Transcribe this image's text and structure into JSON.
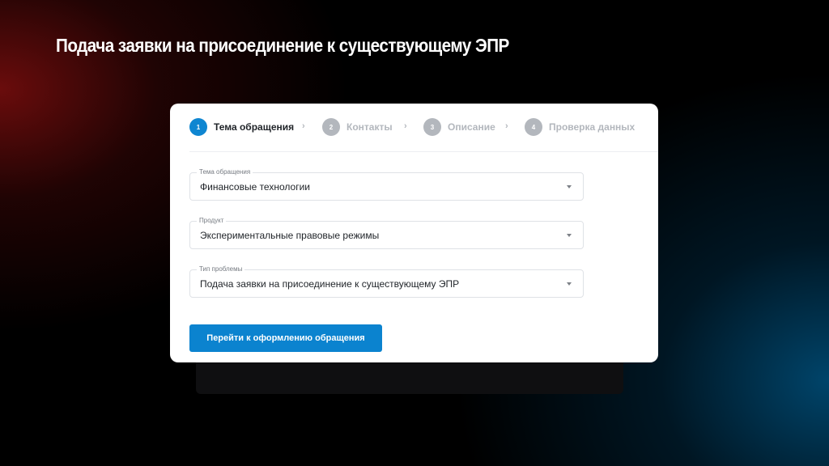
{
  "slide": {
    "title": "Подача заявки на присоединение к существующему ЭПР"
  },
  "stepper": {
    "steps": [
      {
        "number": "1",
        "label": "Тема обращения",
        "active": true
      },
      {
        "number": "2",
        "label": "Контакты",
        "active": false
      },
      {
        "number": "3",
        "label": "Описание",
        "active": false
      },
      {
        "number": "4",
        "label": "Проверка данных",
        "active": false
      }
    ],
    "separator_icon": "chevron-right-icon"
  },
  "form": {
    "topic": {
      "label": "Тема обращения",
      "value": "Финансовые технологии"
    },
    "product": {
      "label": "Продукт",
      "value": "Экспериментальные правовые режимы"
    },
    "problem_type": {
      "label": "Тип проблемы",
      "value": "Подача заявки на присоединение к существующему ЭПР"
    },
    "submit_label": "Перейти к оформлению обращения"
  },
  "colors": {
    "accent": "#0b83cf",
    "inactive_step": "#b3b7bd",
    "text": "#1f2328"
  }
}
